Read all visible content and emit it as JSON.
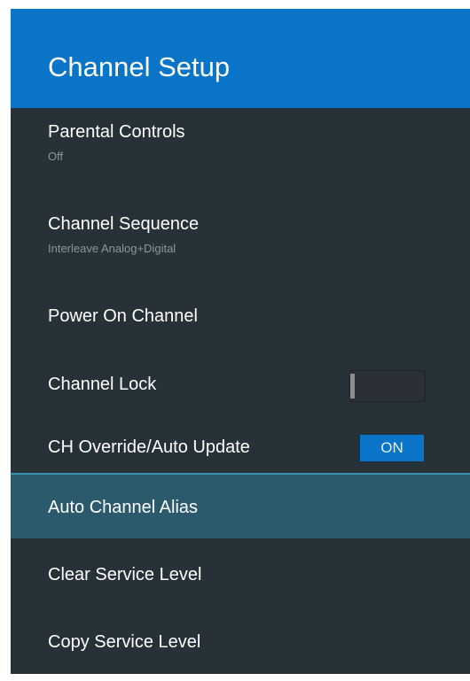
{
  "header": {
    "title": "Channel Setup"
  },
  "menu": {
    "items": [
      {
        "label": "Parental Controls",
        "subtitle": "Off"
      },
      {
        "label": "Channel Sequence",
        "subtitle": "Interleave Analog+Digital"
      },
      {
        "label": "Power On Channel"
      },
      {
        "label": "Channel Lock",
        "toggle_state": "off"
      },
      {
        "label": "CH Override/Auto Update",
        "toggle_label": "ON"
      },
      {
        "label": "Auto Channel Alias",
        "selected": true
      },
      {
        "label": "Clear Service Level"
      },
      {
        "label": "Copy Service Level"
      }
    ]
  },
  "colors": {
    "header_bg": "#0a74c8",
    "panel_bg": "#263238",
    "selected_bg": "#2b5a6d",
    "toggle_on": "#0a74c8"
  }
}
